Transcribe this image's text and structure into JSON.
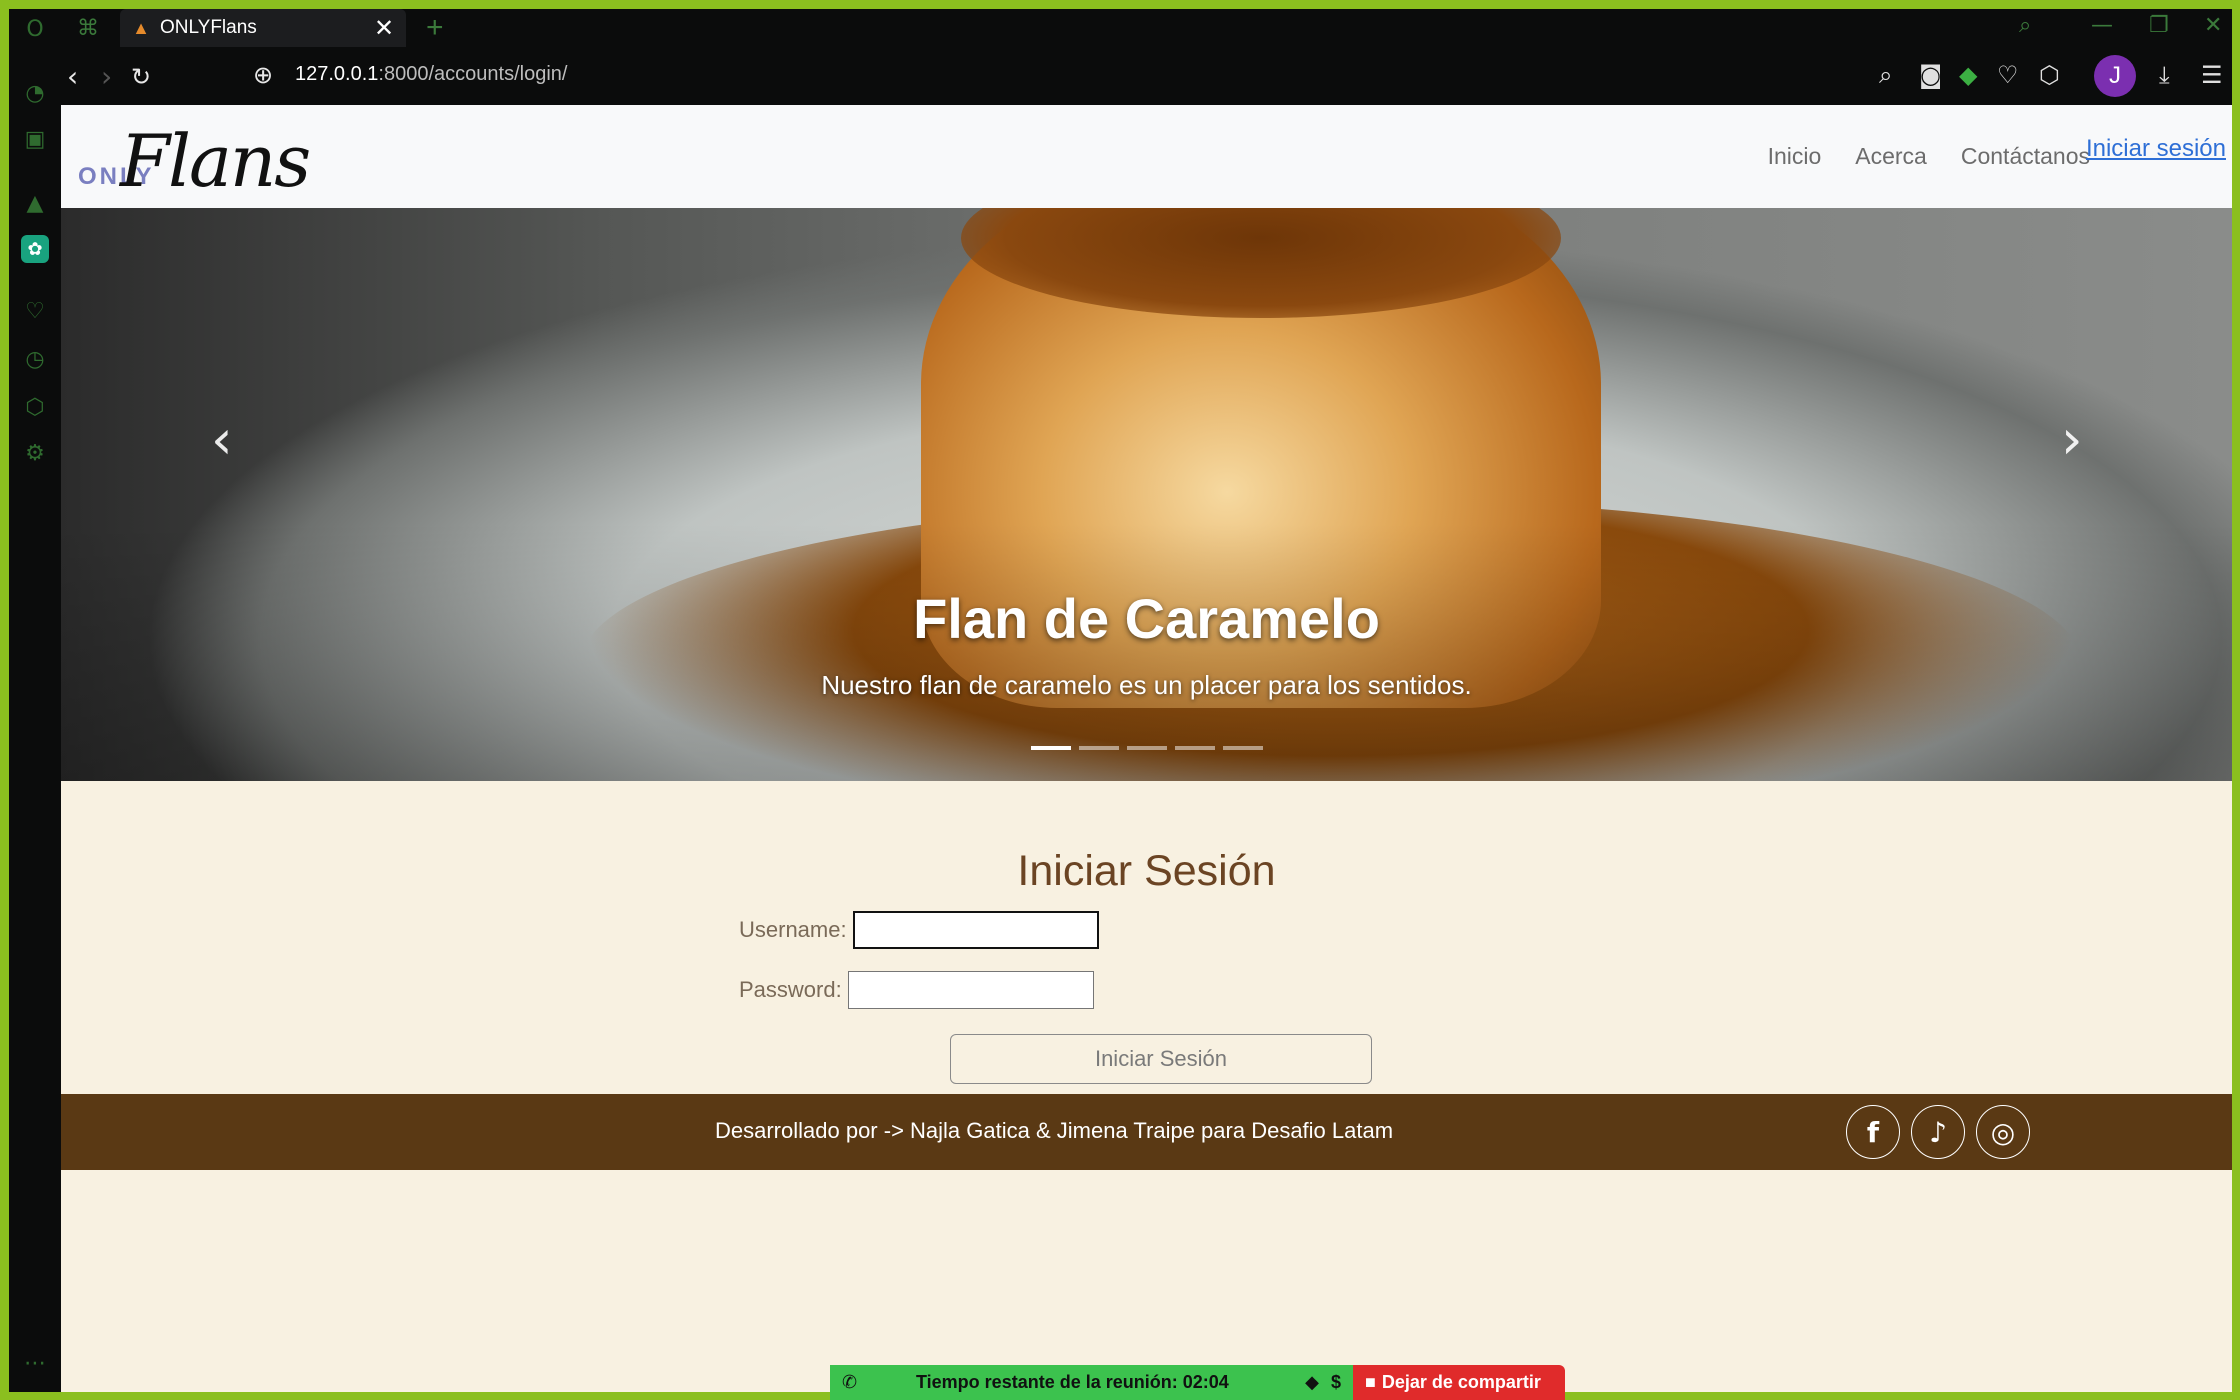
{
  "browser": {
    "tab_title": "ONLYFlans",
    "url_host": "127.0.0.1",
    "url_path": ":8000/accounts/login/",
    "avatar_letter": "J"
  },
  "navbar": {
    "logo_only": "ONLY",
    "logo_flans": "Flans",
    "links": [
      "Inicio",
      "Acerca",
      "Contáctanos"
    ],
    "login_link": "Iniciar sesión"
  },
  "carousel": {
    "title": "Flan de Caramelo",
    "subtitle": "Nuestro flan de caramelo es un placer para los sentidos.",
    "slide_count": 5,
    "active_index": 0
  },
  "login": {
    "heading": "Iniciar Sesión",
    "username_label": "Username:",
    "username_value": "",
    "password_label": "Password:",
    "password_value": "",
    "submit_label": "Iniciar Sesión"
  },
  "footer": {
    "text": "Desarrollado por -> Najla Gatica & Jimena Traipe para Desafio Latam",
    "social": [
      "facebook",
      "tiktok",
      "instagram"
    ]
  },
  "meeting_bar": {
    "time_text": "Tiempo restante de la reunión: 02:04",
    "stop_label": "Dejar de compartir"
  },
  "colors": {
    "brand_brown": "#5a3914",
    "heading_brown": "#6b4423",
    "page_bg": "#f8f1e1",
    "link_blue": "#2e6fd6",
    "frame_green": "#8bbf1f"
  }
}
